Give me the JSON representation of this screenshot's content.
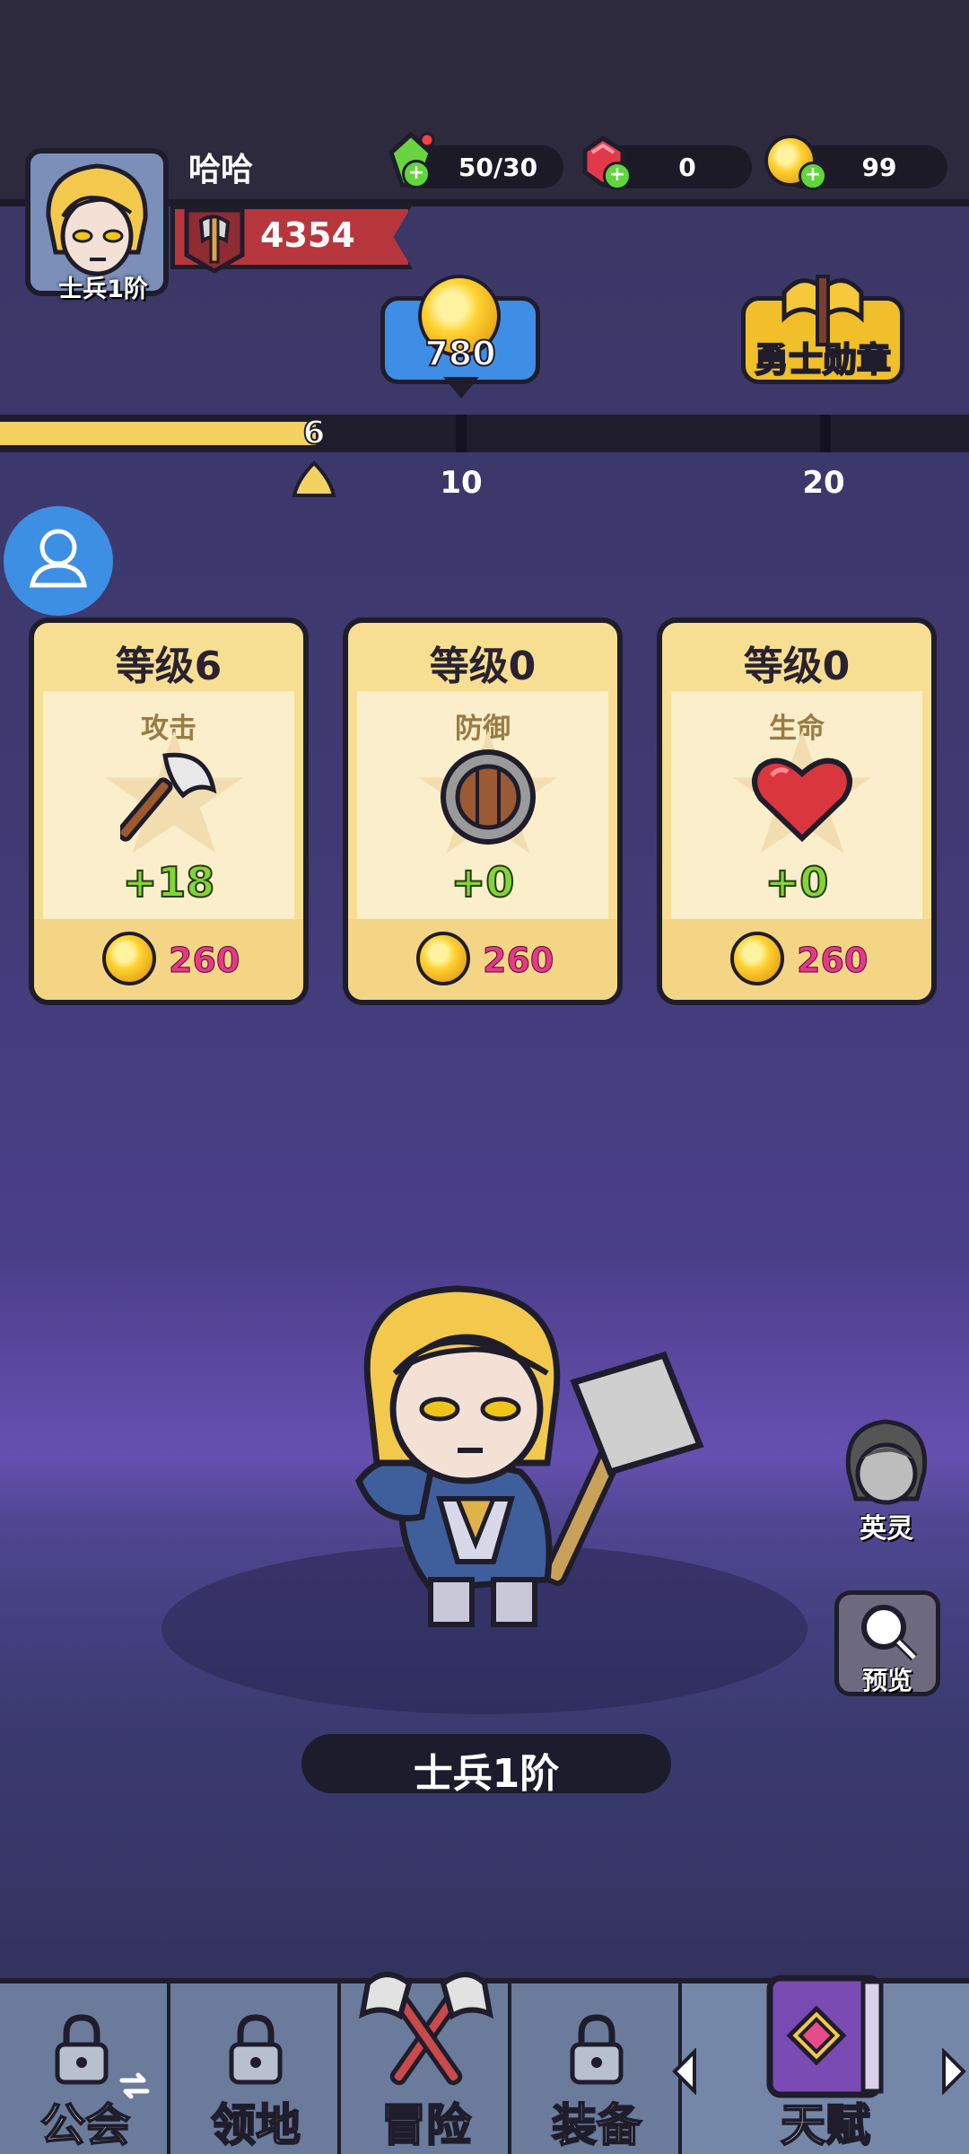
{
  "header": {
    "player_name": "哈哈",
    "rank_label": "士兵1阶",
    "power": "4354",
    "resources": [
      {
        "name": "energy",
        "icon": "green-crystal-icon",
        "value": "50/30"
      },
      {
        "name": "gems",
        "icon": "red-gem-icon",
        "value": "0"
      },
      {
        "name": "coins",
        "icon": "gold-coin-icon",
        "value": "99"
      }
    ]
  },
  "rewards": {
    "coin_reward": "780",
    "medal_label": "勇士勋章"
  },
  "progress": {
    "current": "6",
    "value": 6,
    "max": 20,
    "milestones": [
      "10",
      "20"
    ]
  },
  "cards": [
    {
      "level": "等级6",
      "stat": "攻击",
      "icon": "axe-icon",
      "bonus": "+18",
      "cost": "260"
    },
    {
      "level": "等级0",
      "stat": "防御",
      "icon": "shield-icon",
      "bonus": "+0",
      "cost": "260"
    },
    {
      "level": "等级0",
      "stat": "生命",
      "icon": "heart-icon",
      "bonus": "+0",
      "cost": "260"
    }
  ],
  "hero": {
    "name": "士兵1阶",
    "side_buttons": [
      {
        "label": "英灵",
        "icon": "spirit-avatar-icon"
      },
      {
        "label": "预览",
        "icon": "magnifier-icon"
      }
    ]
  },
  "nav": [
    {
      "label": "公会",
      "icon": "lock-icon",
      "locked": true
    },
    {
      "label": "领地",
      "icon": "lock-icon",
      "locked": true
    },
    {
      "label": "冒险",
      "icon": "crossed-axes-icon",
      "locked": false
    },
    {
      "label": "装备",
      "icon": "lock-icon",
      "locked": true
    },
    {
      "label": "天赋",
      "icon": "spellbook-icon",
      "locked": false,
      "selected": true
    }
  ],
  "colors": {
    "accent_yellow": "#f3d261",
    "card_bg": "#f6df93",
    "bonus_green": "#7fd63b",
    "cost_pink": "#e6398a",
    "nav_bg": "#5d6e8f"
  }
}
